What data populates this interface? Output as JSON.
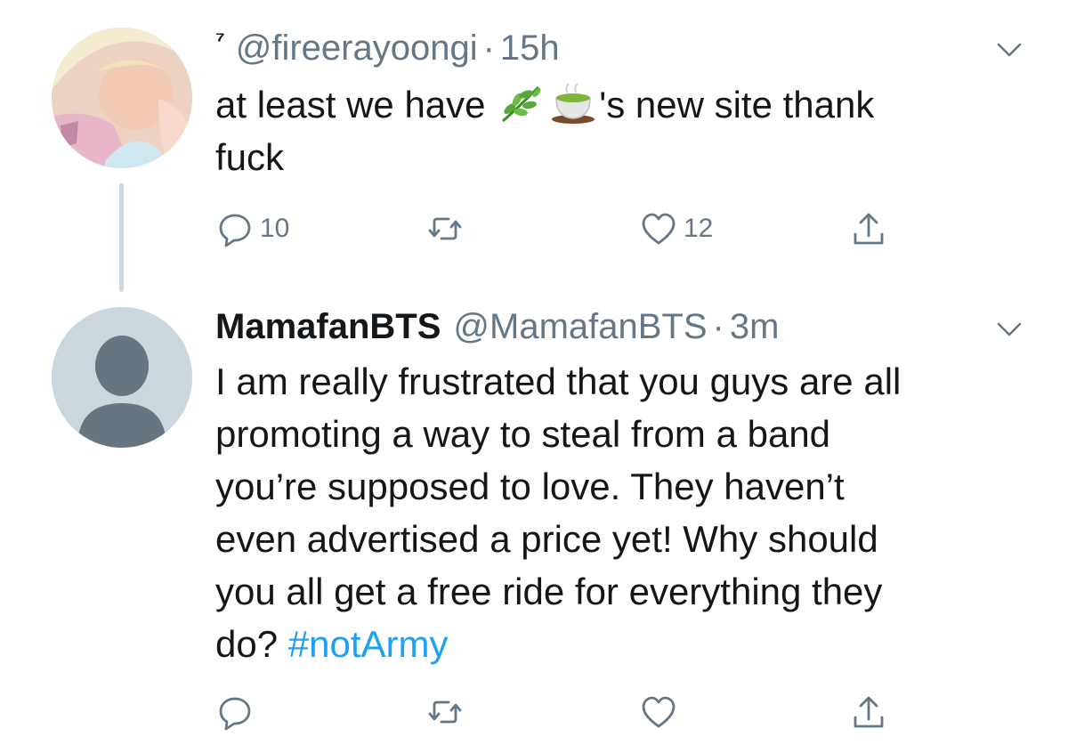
{
  "colors": {
    "icon_gray": "#657786",
    "link_blue": "#1da1f2",
    "text_dark": "#14171a",
    "thread_line": "#ccd6dd"
  },
  "tweets": [
    {
      "display_name": "⁷",
      "handle": "@fireerayoongi",
      "separator": "·",
      "time": "15h",
      "text_part1": "at least we have ",
      "emojis": [
        "herb-emoji",
        "tea-cup-emoji"
      ],
      "text_part2": "'s new site thank\nfuck",
      "hashtag": "",
      "reply_count": "10",
      "retweet_count": "",
      "like_count": "12",
      "icons": [
        "reply-icon",
        "retweet-icon",
        "like-icon",
        "share-icon",
        "chevron-down-icon"
      ]
    },
    {
      "display_name": "MamafanBTS",
      "handle": "@MamafanBTS",
      "separator": "·",
      "time": "3m",
      "text_part1": "I am really frustrated that you guys are all\npromoting a way to steal from a band\nyou’re supposed to love. They haven’t\neven advertised a price yet! Why should\nyou all get a free ride for everything they\ndo? ",
      "hashtag": "#notArmy",
      "reply_count": "",
      "retweet_count": "",
      "like_count": "",
      "icons": [
        "reply-icon",
        "retweet-icon",
        "like-icon",
        "share-icon",
        "chevron-down-icon"
      ]
    }
  ]
}
